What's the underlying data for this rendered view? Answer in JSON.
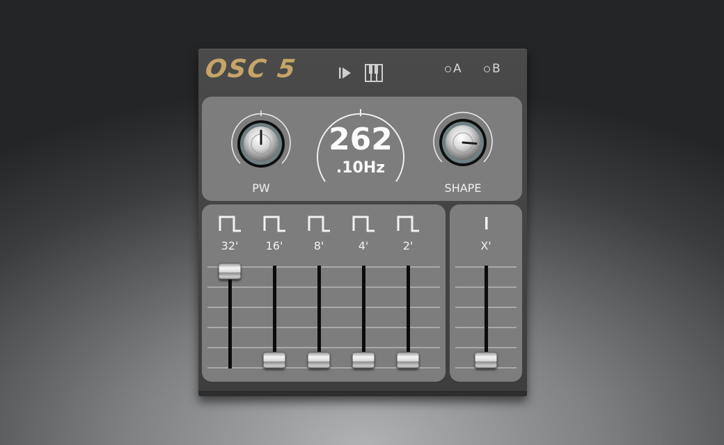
{
  "module": {
    "title": "OSC 5",
    "header_icons": [
      "play-step-icon",
      "keyboard-icon"
    ],
    "modes": [
      {
        "label": "A",
        "icon": "radio-icon"
      },
      {
        "label": "B",
        "icon": "radio-icon"
      }
    ]
  },
  "knobs": {
    "pw": {
      "label": "PW",
      "value": 0.5
    },
    "shape": {
      "label": "SHAPE",
      "value": 0.85
    }
  },
  "frequency": {
    "whole": "262",
    "fraction": ".10Hz"
  },
  "faders": [
    {
      "label": "32'",
      "wave": "square-wave-icon",
      "level": 1.0
    },
    {
      "label": "16'",
      "wave": "square-wave-icon",
      "level": 0.0
    },
    {
      "label": "8'",
      "wave": "square-wave-icon",
      "level": 0.0
    },
    {
      "label": "4'",
      "wave": "square-wave-icon",
      "level": 0.0
    },
    {
      "label": "2'",
      "wave": "square-wave-icon",
      "level": 0.0
    }
  ],
  "aux_fader": {
    "label": "X'",
    "wave": "noise-bar-icon",
    "level": 0.0
  },
  "colors": {
    "title": "#c5a468",
    "panel": "#7d7d7d",
    "module": "#444444"
  }
}
